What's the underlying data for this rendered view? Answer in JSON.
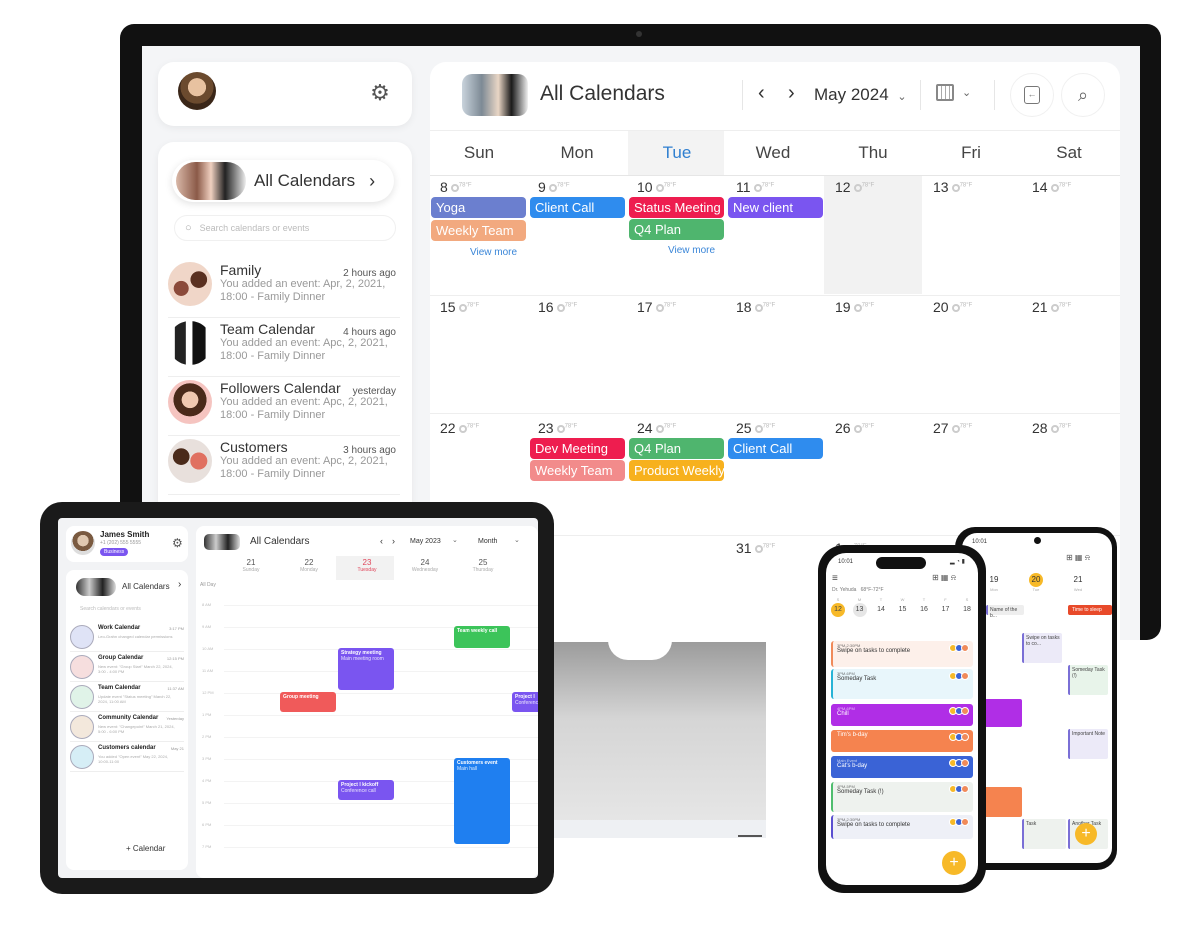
{
  "desktop": {
    "sidebar": {
      "all_calendars_label": "All Calendars",
      "search_placeholder": "Search calendars or events",
      "calendars": [
        {
          "name": "Family",
          "time": "2 hours ago",
          "line1": "You added an event: Apr, 2, 2021,",
          "line2": "18:00 - Family Dinner"
        },
        {
          "name": "Team Calendar",
          "time": "4 hours ago",
          "line1": "You added an event: Apc, 2, 2021,",
          "line2": "18:00 - Family Dinner"
        },
        {
          "name": "Followers Calendar",
          "time": "yesterday",
          "line1": "You added an event: Apc, 2, 2021,",
          "line2": "18:00 - Family Dinner"
        },
        {
          "name": "Customers",
          "time": "3 hours ago",
          "line1": "You added an event: Apc, 2, 2021,",
          "line2": "18:00 - Family Dinner"
        }
      ]
    },
    "header": {
      "title": "All Calendars",
      "month": "May 2024",
      "prev": "‹",
      "next": "›"
    },
    "days_of_week": [
      "Sun",
      "Mon",
      "Tue",
      "Wed",
      "Thu",
      "Fri",
      "Sat"
    ],
    "today_dow": "Tue",
    "weeks": [
      [
        "8",
        "9",
        "10",
        "11",
        "12",
        "13",
        "14"
      ],
      [
        "15",
        "16",
        "17",
        "18",
        "19",
        "20",
        "21"
      ],
      [
        "22",
        "23",
        "24",
        "25",
        "26",
        "27",
        "28"
      ],
      [
        "",
        "",
        "",
        "31",
        "1",
        "",
        ""
      ]
    ],
    "temp_label": "78°F",
    "events": {
      "yoga": "Yoga",
      "weekly_team_8": "Weekly Team",
      "client_call_9": "Client Call",
      "status_meeting": "Status Meeting",
      "q4_plan_10": "Q4 Plan",
      "new_client": "New client",
      "dev_meeting": "Dev Meeting",
      "weekly_team_23": "Weekly Team",
      "q4_plan_24": "Q4 Plan",
      "product_weekly": "Product Weekly",
      "client_call_25": "Client Call"
    },
    "view_more": "View more",
    "colors": {
      "yoga": "#6b7fcf",
      "weekly_team_8": "#f2a97f",
      "client_call": "#2f8cee",
      "status_meeting": "#ee1d4f",
      "q4_plan": "#4fb56e",
      "new_client": "#7a55f0",
      "dev_meeting": "#ee1d4f",
      "weekly_team_23": "#f28b8b",
      "product_weekly": "#f7b11e",
      "today": "#2f7fd0"
    }
  },
  "tablet": {
    "user_name": "James Smith",
    "user_phone": "+1 (202) 555 5555",
    "user_badge": "Business",
    "all_calendars_label": "All Calendars",
    "search_placeholder": "Search calendars or events",
    "calendars": [
      {
        "name": "Work Calendar",
        "time": "3:17 PM",
        "line": "Leo-Grahn changed calendar permissions"
      },
      {
        "name": "Group Calendar",
        "time": "12:15 PM",
        "line": "New event: \"Group Start\" March 22, 2024, 3:00 - 4:00 PM"
      },
      {
        "name": "Team Calendar",
        "time": "11:37 AM",
        "line": "Update event \"Status meeting\" March 22, 2024, 11:00 AM"
      },
      {
        "name": "Community Calendar",
        "time": "Yesterday",
        "line": "New event: \"Changepoint\" March 21, 2024, 5:00 - 6:00 PM"
      },
      {
        "name": "Customers calendar",
        "time": "May 21",
        "line": "You added \"Open event\" May 22, 2024, 10:00-11:00"
      }
    ],
    "add_calendar": "+ Calendar",
    "header_title": "All Calendars",
    "month": "May 2023",
    "view": "Month",
    "days": [
      {
        "num": "21",
        "name": "Sunday"
      },
      {
        "num": "22",
        "name": "Monday"
      },
      {
        "num": "23",
        "name": "Tuesday"
      },
      {
        "num": "24",
        "name": "Wednesday"
      },
      {
        "num": "25",
        "name": "Thursday"
      }
    ],
    "all_day": "All Day",
    "hours": [
      "8 AM",
      "9 AM",
      "10 AM",
      "11 AM",
      "12 PM",
      "1 PM",
      "2 PM",
      "3 PM",
      "4 PM",
      "5 PM",
      "6 PM",
      "7 PM"
    ],
    "events": [
      {
        "title": "Team weekly call",
        "sub": "",
        "color": "#3cc45a"
      },
      {
        "title": "Strategy meeting",
        "sub": "Main meeting room",
        "color": "#7a55f0"
      },
      {
        "title": "Group meeting",
        "sub": "",
        "color": "#f05a5a"
      },
      {
        "title": "Project I",
        "sub": "Conference",
        "color": "#7a55f0"
      },
      {
        "title": "Customers event",
        "sub": "Main hall",
        "color": "#1f7ff0"
      },
      {
        "title": "Project I kickoff",
        "sub": "Conference call",
        "color": "#7a55f0"
      }
    ]
  },
  "phone1": {
    "time": "10:01",
    "location": "Dr. Yehuda",
    "weather": "68°F-72°F",
    "week_letters": [
      "S",
      "M",
      "T",
      "W",
      "T",
      "F",
      "S"
    ],
    "week_days": [
      "12",
      "13",
      "14",
      "15",
      "16",
      "17",
      "18"
    ],
    "tasks": [
      {
        "meta": "3PM-2:30PM",
        "title": "Swipe on tasks to complete",
        "bg": "#fdf0ea",
        "bar": "#f08a5a",
        "dark": false
      },
      {
        "meta": "3PM-6PM",
        "title": "Someday Task",
        "bg": "#e8f6fb",
        "bar": "#27b3d6",
        "dark": false
      },
      {
        "meta": "4PM-6PM",
        "title": "Chill",
        "bg": "#b02ee6",
        "bar": "#b02ee6",
        "dark": true
      },
      {
        "meta": "",
        "title": "Tim's b-day",
        "bg": "#f5834f",
        "bar": "#f5834f",
        "dark": true
      },
      {
        "meta": "Main Event",
        "title": "Cat's b-day",
        "bg": "#3a63d6",
        "bar": "#3a63d6",
        "dark": true
      },
      {
        "meta": "4PM-5PM",
        "title": "Someday Task (!)",
        "bg": "#eef2ee",
        "bar": "#4fbd6e",
        "dark": false
      },
      {
        "meta": "3PM-2:30PM",
        "title": "Swipe on tasks to complete",
        "bg": "#eef0f7",
        "bar": "#5a4fd0",
        "dark": false
      }
    ],
    "fab": "+"
  },
  "phone2": {
    "time": "10:01",
    "days": [
      {
        "num": "19",
        "name": "Mon"
      },
      {
        "num": "20",
        "name": "Tue"
      },
      {
        "num": "21",
        "name": "Wed"
      }
    ],
    "events": [
      {
        "title": "Name of the b...",
        "color": "#eeeeee"
      },
      {
        "title": "Time to sleep",
        "color": "#e84a2a"
      },
      {
        "title": "Swipe on tasks to co...",
        "color": "#eceaf8"
      },
      {
        "title": "Someday Task (!)",
        "color": "#e8f4ea"
      },
      {
        "title": "Important Note",
        "color": "#eceaf8"
      },
      {
        "title": "Task",
        "color": "#eef2ee"
      },
      {
        "title": "Another Task",
        "color": "#eef2ee"
      }
    ],
    "fab": "+"
  }
}
